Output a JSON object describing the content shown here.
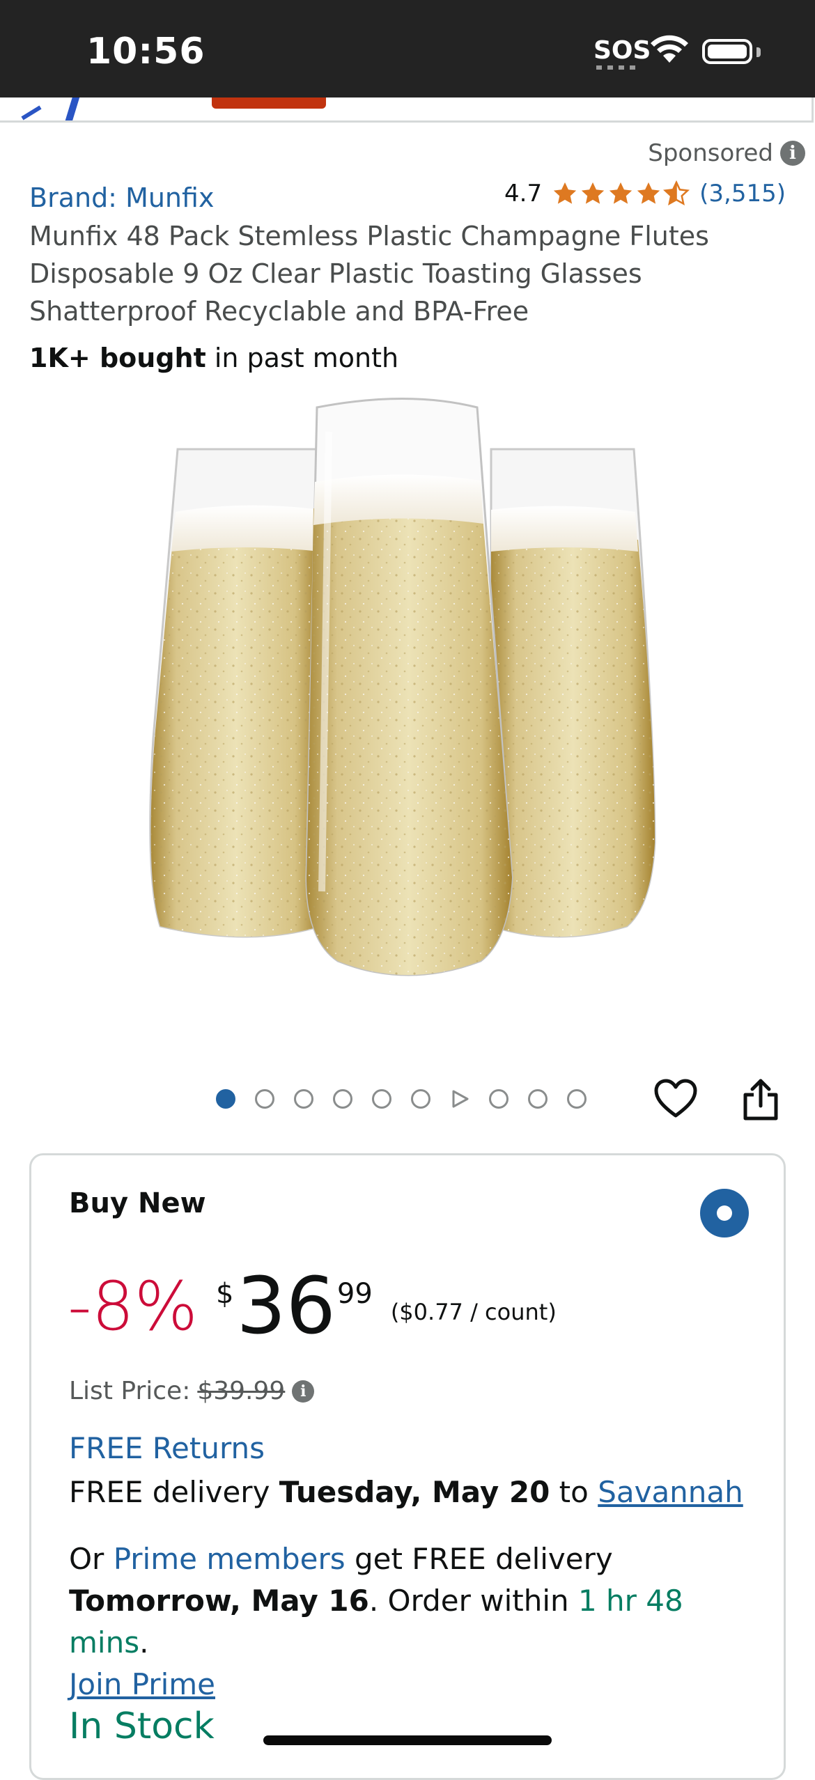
{
  "status_bar": {
    "time": "10:56",
    "sos": "SOS"
  },
  "sponsored": {
    "label": "Sponsored",
    "info": "i"
  },
  "product": {
    "brand": "Brand: Munfix",
    "rating": "4.7",
    "rating_stars": 4.7,
    "rating_count": "(3,515)",
    "title": "Munfix 48 Pack Stemless Plastic Champagne Flutes Disposable 9 Oz Clear Plastic Toasting Glasses Shatterproof Recyclable and BPA-Free",
    "bought_bold": "1K+ bought",
    "bought_rest": " in past month",
    "image_icon": "champagne-flutes-image"
  },
  "carousel": {
    "total": 10,
    "active_index": 0,
    "video_index": 6
  },
  "buy_box": {
    "title": "Buy New",
    "discount": "-8%",
    "currency": "$",
    "price_whole": "36",
    "price_fraction": "99",
    "per_unit": "($0.77 / count)",
    "list_price_label": "List Price: ",
    "list_price": "$39.99",
    "free_returns": "FREE Returns",
    "delivery_prefix": "FREE delivery ",
    "delivery_date": "Tuesday, May 20",
    "delivery_to": " to ",
    "delivery_location": "Savannah",
    "prime_or": "Or ",
    "prime_members": "Prime members",
    "prime_get": " get FREE delivery",
    "prime_date": "Tomorrow, May 16",
    "prime_order": ". Order within ",
    "prime_countdown": "1 hr 48 mins",
    "prime_period": ".",
    "join_prime": "Join Prime",
    "stock": "In Stock"
  },
  "colors": {
    "link": "#2162a1",
    "deal": "#cc0c39",
    "stock": "#067d62",
    "star": "#de7921"
  }
}
